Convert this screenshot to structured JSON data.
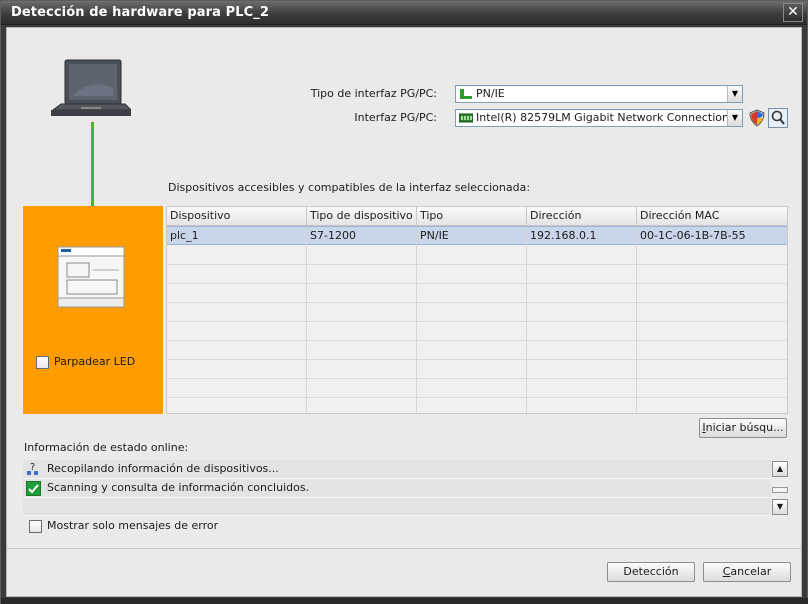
{
  "window": {
    "title": "Detección de hardware para PLC_2",
    "close_glyph": "✕"
  },
  "interface": {
    "type_label": "Tipo de interfaz PG/PC:",
    "type_value": "PN/IE",
    "iface_label": "Interfaz PG/PC:",
    "iface_value": "Intel(R) 82579LM Gigabit Network Connection"
  },
  "devices_section_label": "Dispositivos accesibles y compatibles de la interfaz seleccionada:",
  "table": {
    "columns": [
      "Dispositivo",
      "Tipo de dispositivo",
      "Tipo",
      "Dirección",
      "Dirección MAC"
    ],
    "rows": [
      {
        "device": "plc_1",
        "device_type": "S7-1200",
        "type": "PN/IE",
        "address": "192.168.0.1",
        "mac": "00-1C-06-1B-7B-55"
      }
    ]
  },
  "flash_led_label": "Parpadear LED",
  "start_search_label_u": "I",
  "start_search_label_rest": "niciar búsqu...",
  "status": {
    "title": "Información de estado online:",
    "lines": [
      {
        "icon": "gathering-info-icon",
        "text": "Recopilando información de dispositivos..."
      },
      {
        "icon": "green-check-icon",
        "text": "Scanning y consulta de información concluidos."
      }
    ]
  },
  "only_errors_label": "Mostrar solo mensajes de error",
  "buttons": {
    "detect": "Detección",
    "cancel_u": "C",
    "cancel_rest": "ancelar"
  },
  "colors": {
    "accent_orange": "#ff9c00",
    "link_green": "#2fbf2f",
    "selection": "#c9d6ea"
  }
}
